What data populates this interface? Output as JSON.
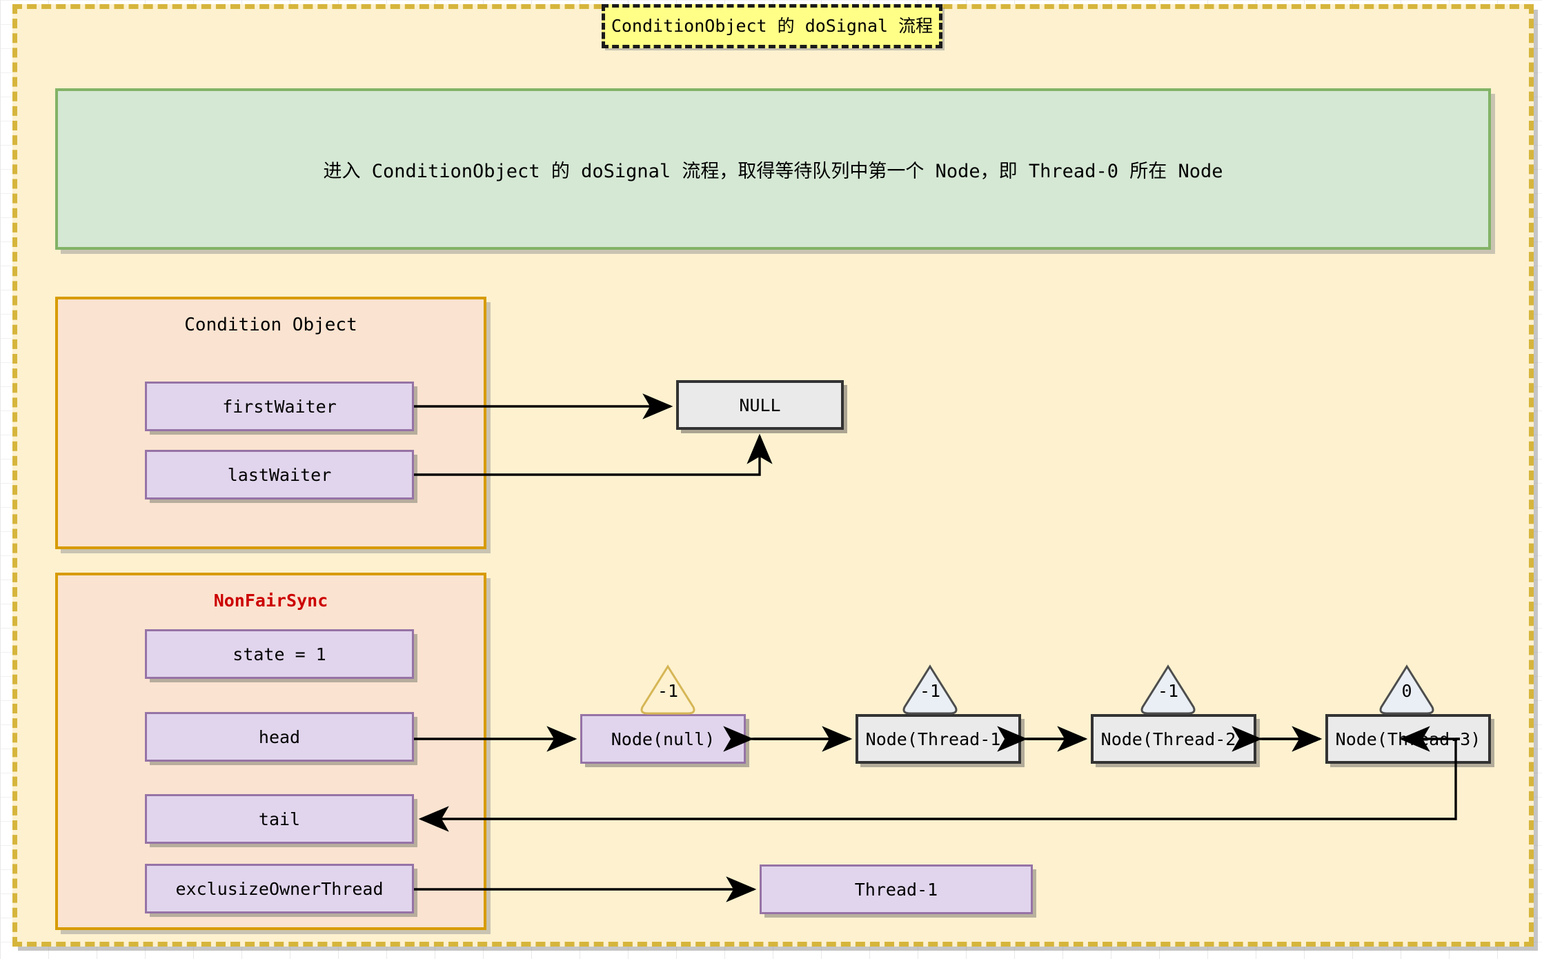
{
  "title": {
    "text": "ConditionObject 的 doSignal 流程",
    "fill": "#ffff88",
    "border": "#1a1a1a"
  },
  "note": {
    "text": "进入 ConditionObject 的 doSignal 流程，取得等待队列中第一个 Node，即 Thread-0 所在 Node",
    "fill": "#d5e8d4",
    "border": "#82b366"
  },
  "colors": {
    "canvas_bg": "#fdf1cf",
    "outer_border": "#d6b53c",
    "panel_fill": "#fae3d0",
    "panel_border": "#d79b00",
    "field_fill": "#e1d5ed",
    "field_border": "#9673a6",
    "gray_fill": "#eaeaea",
    "gray_border": "#333333",
    "accent_red": "#cc0000",
    "gold_tri": "#d6b656"
  },
  "condition_object": {
    "title": "Condition Object",
    "fields": [
      {
        "label": "firstWaiter"
      },
      {
        "label": "lastWaiter"
      }
    ]
  },
  "nonfair_sync": {
    "title": "NonFairSync",
    "fields": [
      {
        "label": "state = 1"
      },
      {
        "label": "head"
      },
      {
        "label": "tail"
      },
      {
        "label": "exclusizeOwnerThread"
      }
    ]
  },
  "null_box": {
    "label": "NULL"
  },
  "owner_thread_box": {
    "label": "Thread-1"
  },
  "queue": {
    "nodes": [
      {
        "label": "Node(null)",
        "wait_status": "-1",
        "style": "purple",
        "tri_style": "gold"
      },
      {
        "label": "Node(Thread-1)",
        "wait_status": "-1",
        "style": "gray",
        "tri_style": "gray"
      },
      {
        "label": "Node(Thread-2)",
        "wait_status": "-1",
        "style": "gray",
        "tri_style": "gray"
      },
      {
        "label": "Node(Thread-3)",
        "wait_status": "0",
        "style": "gray",
        "tri_style": "gray"
      }
    ]
  }
}
